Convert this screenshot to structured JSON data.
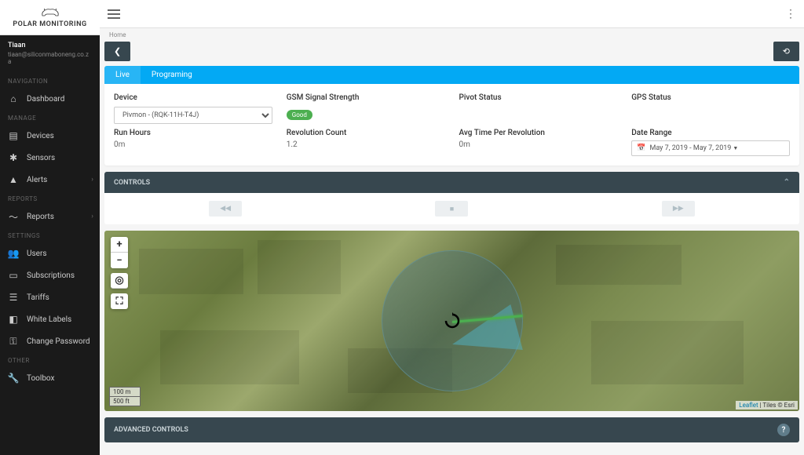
{
  "logo_text": "POLAR MONITORING",
  "user": {
    "name": "Tiaan",
    "email": "tiaan@siliconmaboneng.co.za"
  },
  "nav": {
    "sections": [
      {
        "title": "NAVIGATION",
        "items": [
          {
            "label": "Dashboard",
            "icon": "home"
          }
        ]
      },
      {
        "title": "MANAGE",
        "items": [
          {
            "label": "Devices",
            "icon": "devices"
          },
          {
            "label": "Sensors",
            "icon": "hub"
          },
          {
            "label": "Alerts",
            "icon": "warning",
            "expandable": true
          }
        ]
      },
      {
        "title": "REPORTS",
        "items": [
          {
            "label": "Reports",
            "icon": "trending",
            "expandable": true
          }
        ]
      },
      {
        "title": "SETTINGS",
        "items": [
          {
            "label": "Users",
            "icon": "people"
          },
          {
            "label": "Subscriptions",
            "icon": "card"
          },
          {
            "label": "Tariffs",
            "icon": "receipt"
          },
          {
            "label": "White Labels",
            "icon": "label"
          },
          {
            "label": "Change Password",
            "icon": "key"
          }
        ]
      },
      {
        "title": "OTHER",
        "items": [
          {
            "label": "Toolbox",
            "icon": "build"
          }
        ]
      }
    ]
  },
  "breadcrumb": "Home",
  "tabs": {
    "live": "Live",
    "programing": "Programing"
  },
  "info": {
    "device_label": "Device",
    "device_value": "Pivmon - (RQK-11H-T4J)",
    "gsm_label": "GSM Signal Strength",
    "gsm_badge": "Good",
    "pivot_status_label": "Pivot Status",
    "gps_status_label": "GPS Status",
    "run_hours_label": "Run Hours",
    "run_hours_value": "0m",
    "rev_count_label": "Revolution Count",
    "rev_count_value": "1.2",
    "avg_time_label": "Avg Time Per Revolution",
    "avg_time_value": "0m",
    "date_range_label": "Date Range",
    "date_range_value": "May 7, 2019 - May 7, 2019"
  },
  "controls_title": "CONTROLS",
  "adv_controls_title": "ADVANCED CONTROLS",
  "map": {
    "scale_metric": "100 m",
    "scale_imperial": "500 ft",
    "attrib_leaflet": "Leaflet",
    "attrib_tiles": " | Tiles © Esri"
  }
}
